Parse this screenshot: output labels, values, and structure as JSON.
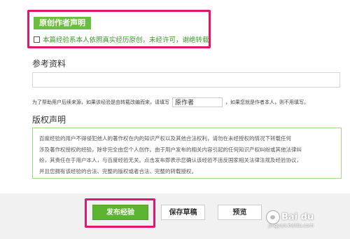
{
  "original": {
    "button_label": "原创作者声明",
    "checkbox_label": "本篇经验系本人依照真实经历原创，未经许可，谢绝转载"
  },
  "reference": {
    "heading": "参考资料",
    "input_value": ""
  },
  "help": {
    "text_before": "为了帮助用户后续来源，如果该经验是由转载改编而来，请填写",
    "input_value": "原作者",
    "text_after": "，如果您就是作者本人，则不用填写。"
  },
  "copyright": {
    "heading": "版权声明",
    "lines": [
      "百度经验的用户不得侵犯他人的著作权在内的知识产权以及其他合法权利，请勿在未经授权的情况下转载任何",
      "涉及著作权授权的经验，除非完全由您个人创作。由于用户发布的相关内容引起的任何知识产权纠纷或其他法律纠",
      "纷，其责任在于用户本人，与百度经验无关。点击发布即表示您确认该经验不违反国家相关法律法规及经验协议，",
      "并且您拥有该经验的合法、完整的版权或者合法、完整的转载授权。"
    ]
  },
  "actions": {
    "publish_label": "发布经验",
    "save_draft_label": "保存草稿",
    "preview_label": "预览"
  },
  "watermark": {
    "brand": "Bai du",
    "sub": "jingyan.baidu.com"
  },
  "colors": {
    "highlight": "#e0166f",
    "accent_green": "#6bbf3f"
  }
}
